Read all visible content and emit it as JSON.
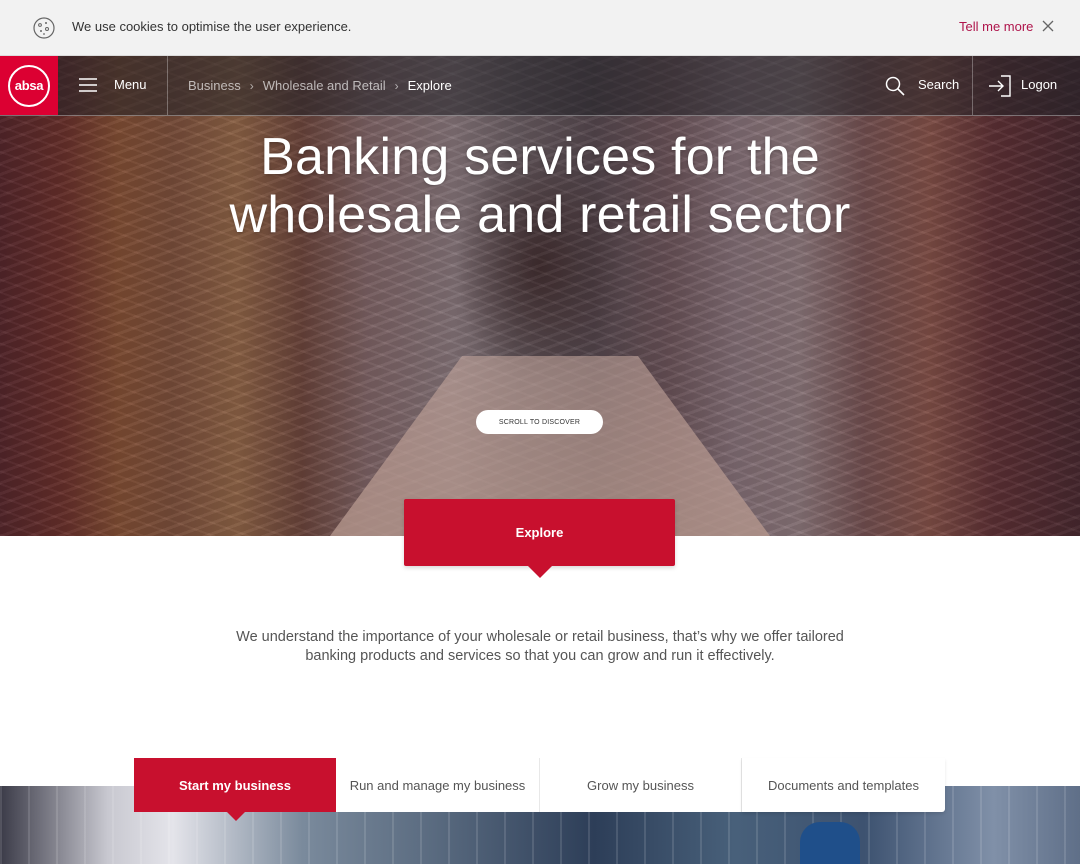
{
  "cookie": {
    "icon": "cookie-icon",
    "message": "We use cookies to optimise the user experience.",
    "more_label": "Tell me more",
    "close_icon": "close-icon",
    "accent_color": "#af144b"
  },
  "nav": {
    "logo_text": "absa",
    "brand_color": "#dc0032",
    "menu_label": "Menu",
    "breadcrumb": [
      {
        "label": "Business"
      },
      {
        "label": "Wholesale and Retail"
      },
      {
        "label": "Explore"
      }
    ],
    "search_label": "Search",
    "logon_label": "Logon"
  },
  "hero": {
    "title_line1": "Banking services for the",
    "title_line2": "wholesale and retail sector",
    "scroll_label": "SCROLL TO DISCOVER"
  },
  "explore": {
    "label": "Explore",
    "color": "#c8102e"
  },
  "intro": {
    "line1": "We understand the importance of your wholesale or retail business, that’s why we offer tailored",
    "line2": "banking products and services so that you can grow and run it effectively."
  },
  "tabs": [
    {
      "label": "Start my business",
      "active": true
    },
    {
      "label": "Run and manage my business",
      "active": false
    },
    {
      "label": "Grow my business",
      "active": false
    },
    {
      "label": "Documents and templates",
      "active": false
    }
  ]
}
